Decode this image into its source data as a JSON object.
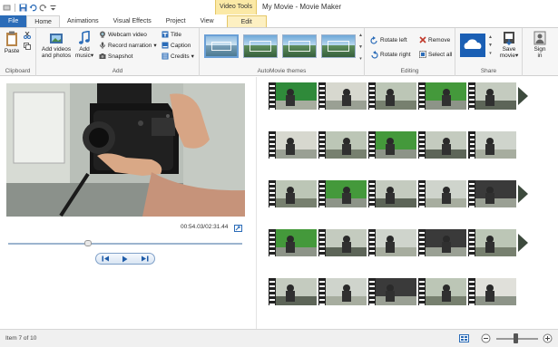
{
  "window": {
    "title": "My Movie - Movie Maker",
    "contextual_group": "Video Tools"
  },
  "tabs": [
    {
      "label": "File"
    },
    {
      "label": "Home"
    },
    {
      "label": "Animations"
    },
    {
      "label": "Visual Effects"
    },
    {
      "label": "Project"
    },
    {
      "label": "View"
    },
    {
      "label": "Edit"
    }
  ],
  "ribbon": {
    "clipboard": {
      "paste": "Paste",
      "label": "Clipboard"
    },
    "add": {
      "add_videos_line1": "Add videos",
      "add_videos_line2": "and photos",
      "add_music_line1": "Add",
      "add_music_line2": "music",
      "webcam": "Webcam video",
      "narration": "Record narration",
      "snapshot": "Snapshot",
      "title": "Title",
      "caption": "Caption",
      "credits": "Credits",
      "label": "Add"
    },
    "themes": {
      "label": "AutoMovie themes"
    },
    "editing": {
      "rotate_left": "Rotate left",
      "rotate_right": "Rotate right",
      "remove": "Remove",
      "select_all": "Select all",
      "label": "Editing"
    },
    "share": {
      "save_line1": "Save",
      "save_line2": "movie",
      "label": "Share"
    },
    "signin": {
      "line1": "Sign",
      "line2": "in"
    }
  },
  "player": {
    "timecode": "00:54.03/02:31.44",
    "progress": 0.34
  },
  "status": {
    "item_text": "Item 7 of 10"
  },
  "zoom": {
    "level": 0.45
  },
  "colors": {
    "file_tab": "#2b6cb8",
    "contextual": "#fbe9a6",
    "onedrive": "#1a5fb4"
  }
}
